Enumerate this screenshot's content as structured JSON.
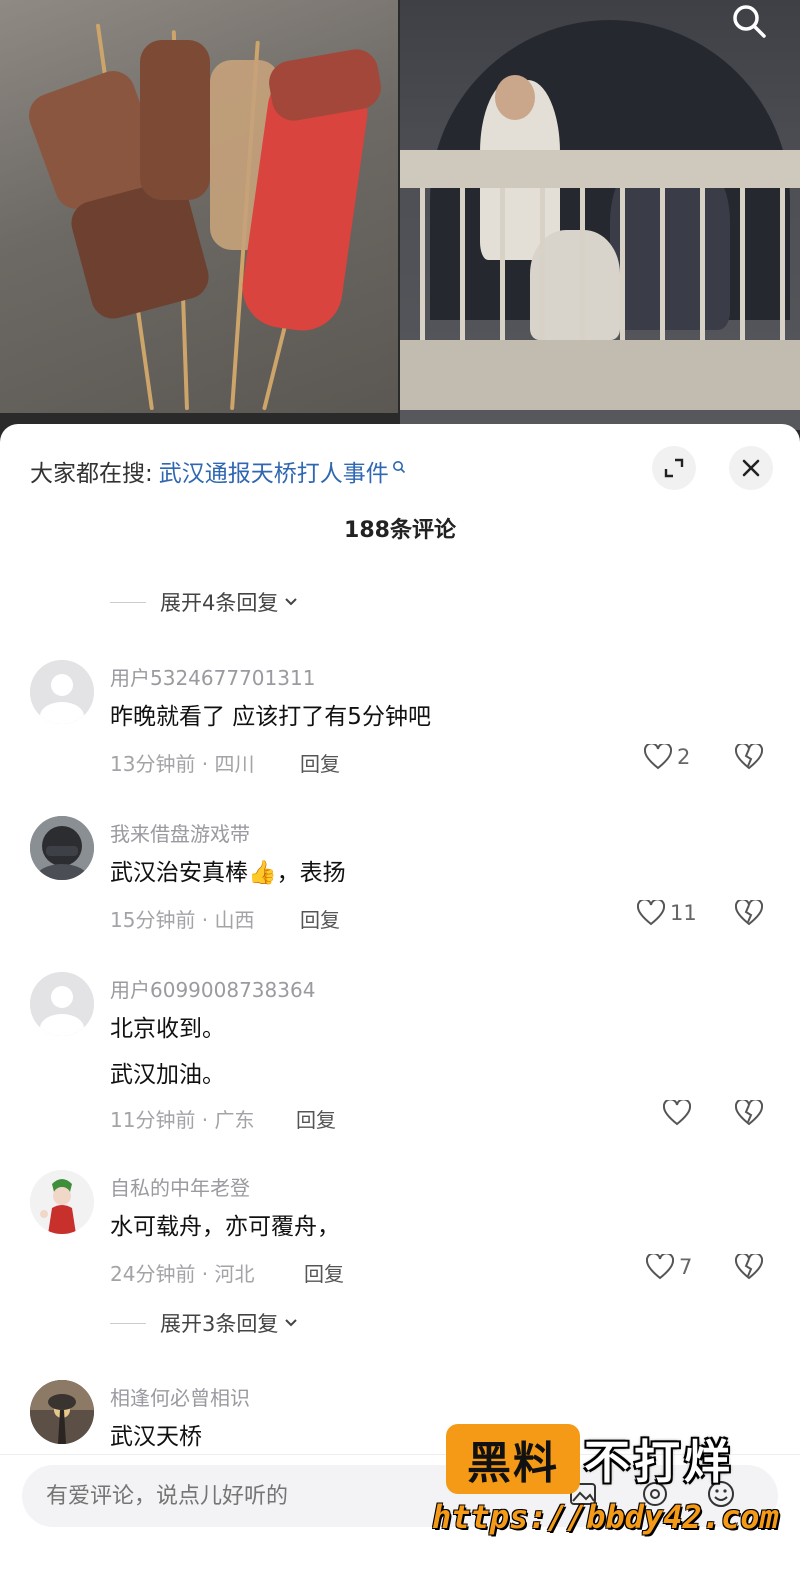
{
  "video": {
    "left_panel": "grilled-skewers-image",
    "right_panel": "bridge-scene-image",
    "search_icon": "search-icon"
  },
  "sheet": {
    "trending_prefix": "大家都在搜:",
    "trending_topic": "武汉通报天桥打人事件",
    "comment_count": "188条评论",
    "expand_icon": "expand-icon",
    "close_icon": "close-icon"
  },
  "expand_replies_1": "展开4条回复",
  "expand_replies_2": "展开3条回复",
  "reply_label": "回复",
  "comments": [
    {
      "user": "用户5324677701311",
      "lines": [
        "昨晚就看了 应该打了有5分钟吧"
      ],
      "meta": "13分钟前 · 四川",
      "likes": "2",
      "avatar": "default-avatar"
    },
    {
      "user": "我来借盘游戏带",
      "lines": [
        "武汉治安真棒👍，表扬"
      ],
      "meta": "15分钟前 · 山西",
      "likes": "11",
      "avatar": "helmet-avatar"
    },
    {
      "user": "用户6099008738364",
      "lines": [
        "北京收到。",
        "武汉加油。"
      ],
      "meta": "11分钟前 · 广东",
      "likes": "",
      "avatar": "default-avatar"
    },
    {
      "user": "自私的中年老登",
      "lines": [
        "水可载舟，亦可覆舟，"
      ],
      "meta": "24分钟前 · 河北",
      "likes": "7",
      "avatar": "joker-avatar"
    },
    {
      "user": "相逢何必曾相识",
      "lines": [
        "武汉天桥"
      ],
      "meta": "",
      "likes": "",
      "avatar": "sunset-avatar"
    }
  ],
  "input": {
    "placeholder": "有爱评论，说点儿好听的",
    "icons": [
      "image-icon",
      "at-icon",
      "emoji-icon"
    ]
  },
  "watermark": {
    "logo_text": "黑料",
    "title": "不打烊",
    "url": "https://bbdy42.com"
  },
  "colors": {
    "topic_link": "#2f67b2",
    "watermark_orange": "#f49a17",
    "meta_gray": "#a3a3a8"
  }
}
